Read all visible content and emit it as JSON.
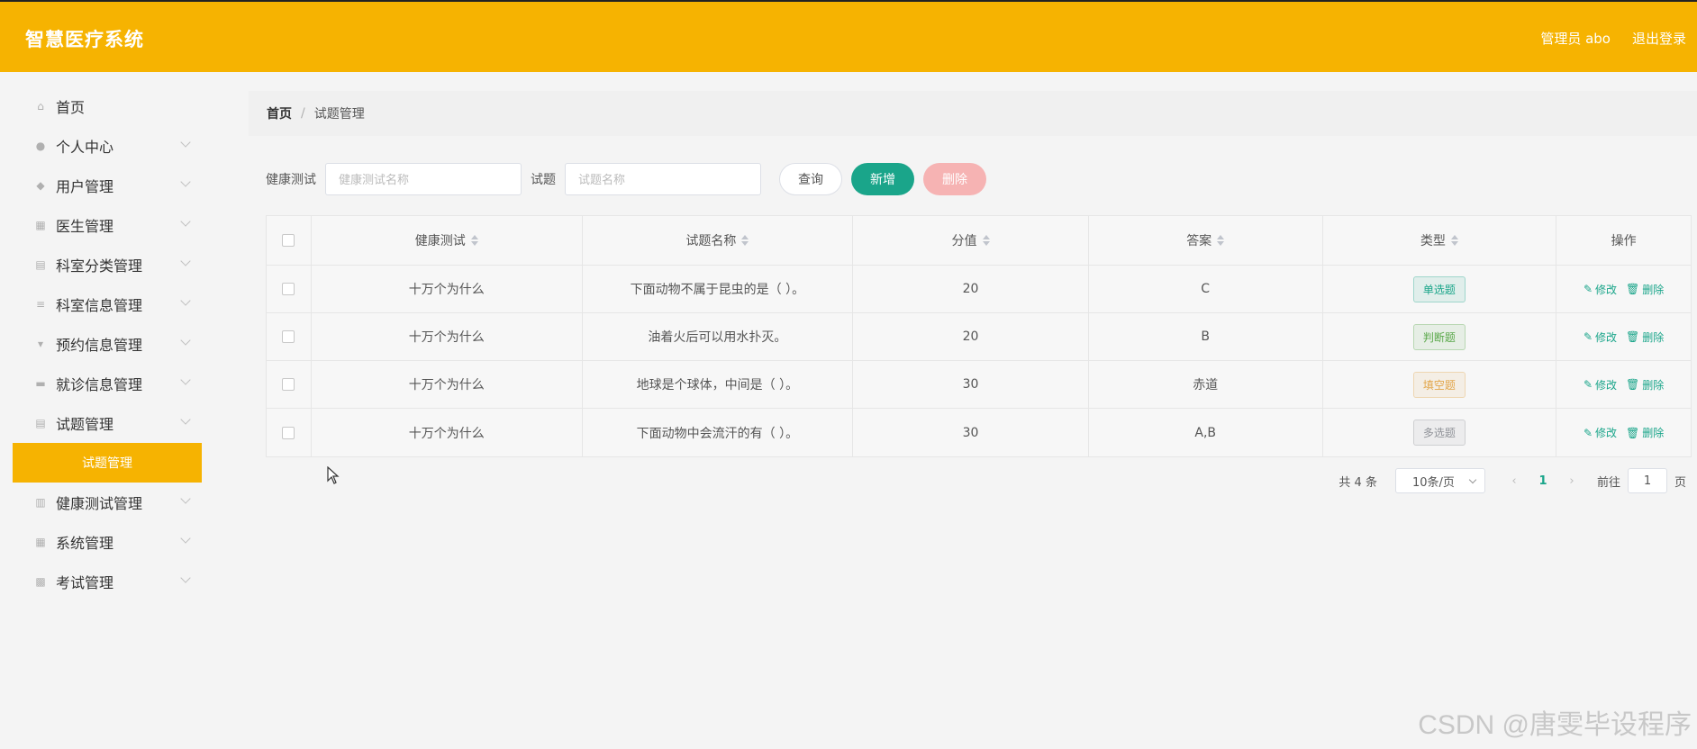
{
  "header": {
    "title": "智慧医疗系统",
    "user": "管理员 abo",
    "logout": "退出登录",
    "bg_color": "#f6b301"
  },
  "sidebar": {
    "items": [
      {
        "label": "首页",
        "icon": "home-icon"
      },
      {
        "label": "个人中心",
        "icon": "user-icon"
      },
      {
        "label": "用户管理",
        "icon": "users-icon"
      },
      {
        "label": "医生管理",
        "icon": "grid-icon"
      },
      {
        "label": "科室分类管理",
        "icon": "clipboard-icon"
      },
      {
        "label": "科室信息管理",
        "icon": "list-icon"
      },
      {
        "label": "预约信息管理",
        "icon": "pin-icon"
      },
      {
        "label": "就诊信息管理",
        "icon": "briefcase-icon"
      },
      {
        "label": "试题管理",
        "icon": "clipboard-icon"
      },
      {
        "label": "健康测试管理",
        "icon": "chart-icon"
      },
      {
        "label": "系统管理",
        "icon": "grid-icon"
      },
      {
        "label": "考试管理",
        "icon": "apps-icon"
      }
    ],
    "active_sub": "试题管理"
  },
  "breadcrumb": {
    "home": "首页",
    "separator": "/",
    "current": "试题管理"
  },
  "filters": {
    "label1": "健康测试",
    "placeholder1": "健康测试名称",
    "label2": "试题",
    "placeholder2": "试题名称",
    "query": "查询",
    "add": "新增",
    "delete": "删除"
  },
  "table": {
    "headers": [
      "健康测试",
      "试题名称",
      "分值",
      "答案",
      "类型",
      "操作"
    ],
    "rows": [
      {
        "test": "十万个为什么",
        "name": "下面动物不属于昆虫的是（ ）。",
        "score": "20",
        "answer": "C",
        "type": "单选题",
        "type_color": "#1aa58a"
      },
      {
        "test": "十万个为什么",
        "name": "油着火后可以用水扑灭。",
        "score": "20",
        "answer": "B",
        "type": "判断题",
        "type_color": "#5aa84a"
      },
      {
        "test": "十万个为什么",
        "name": "地球是个球体，中间是（ ）。",
        "score": "30",
        "answer": "赤道",
        "type": "填空题",
        "type_color": "#e2a64a"
      },
      {
        "test": "十万个为什么",
        "name": "下面动物中会流汗的有（ ）。",
        "score": "30",
        "answer": "A,B",
        "type": "多选题",
        "type_color": "#909399"
      }
    ],
    "edit": "修改",
    "remove": "删除"
  },
  "pagination": {
    "total": "共 4 条",
    "page_size": "10条/页",
    "current_page": "1",
    "goto_label": "前往",
    "goto_value": "1",
    "page_unit": "页"
  },
  "watermark": "CSDN @唐雯毕设程序"
}
